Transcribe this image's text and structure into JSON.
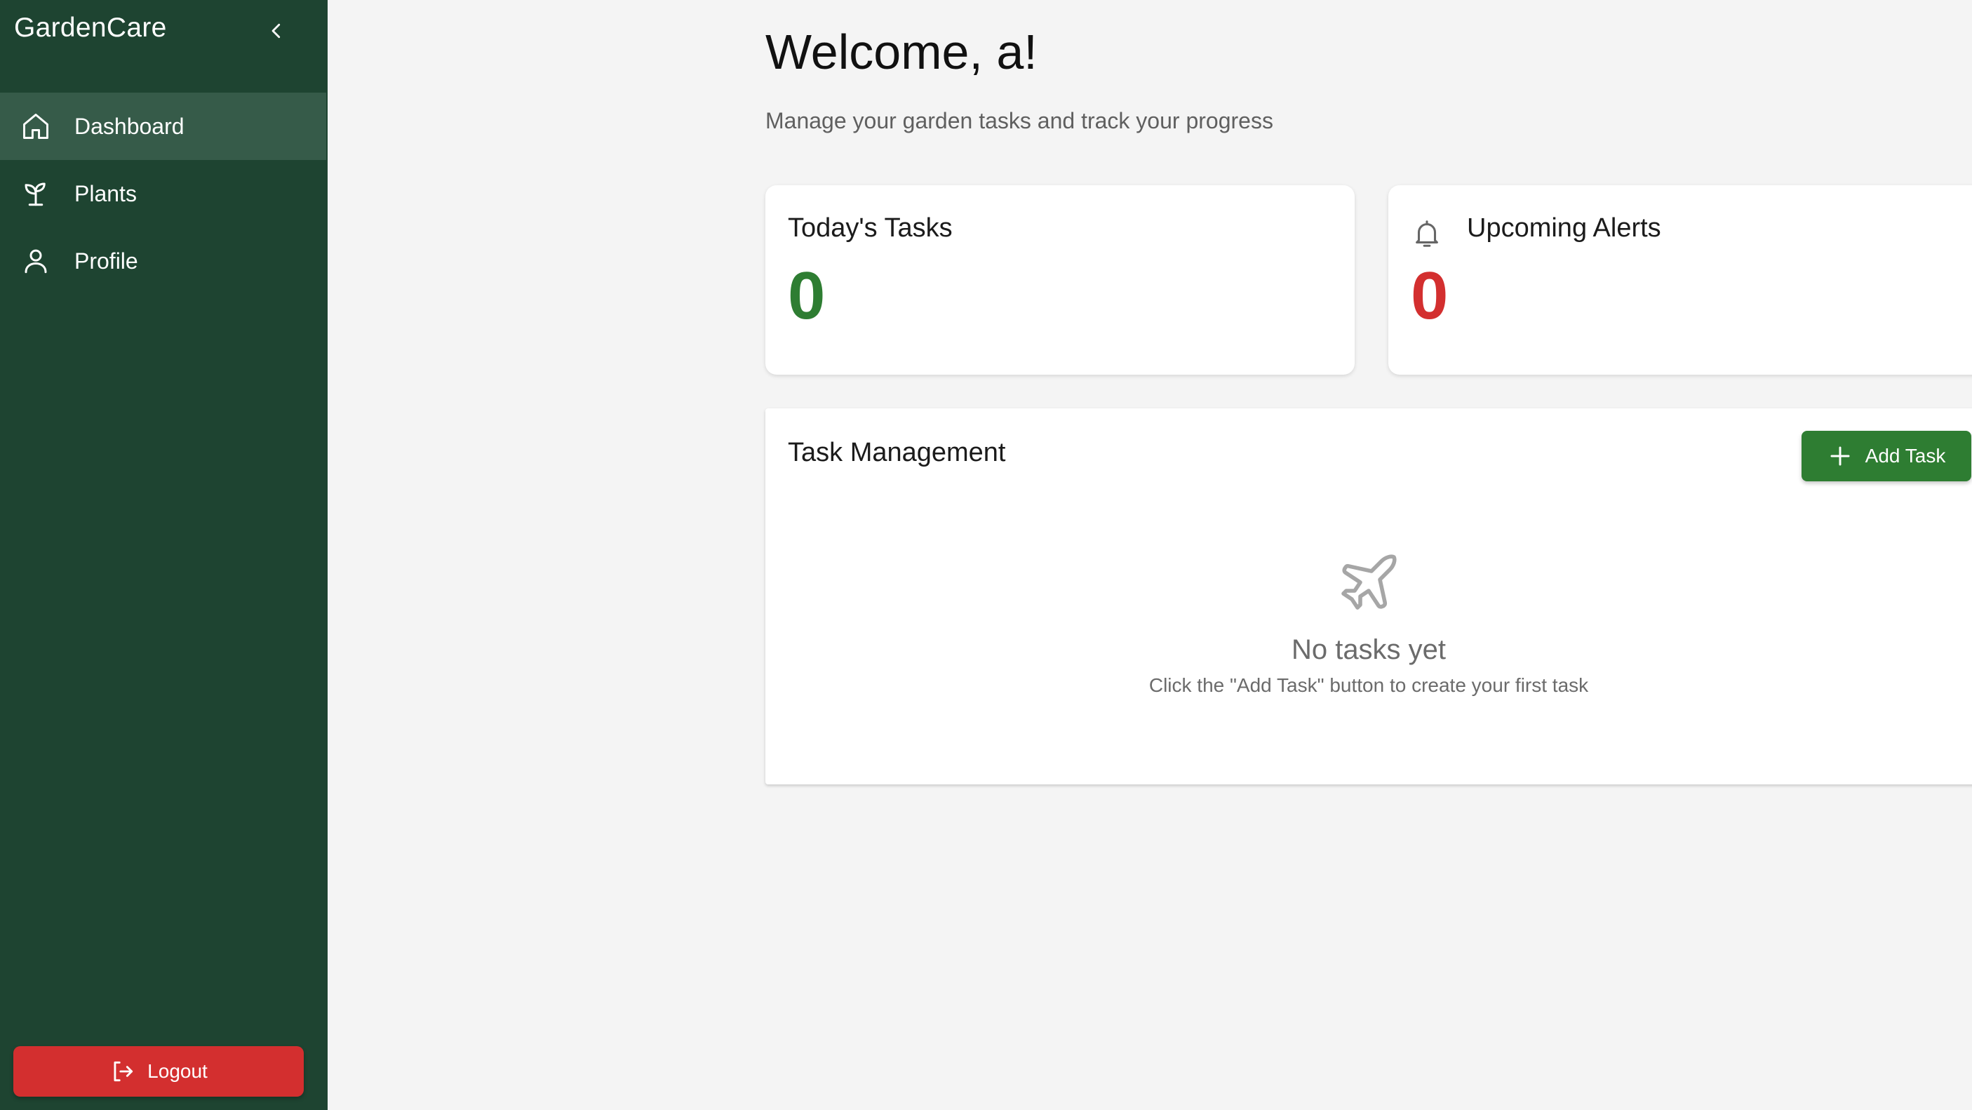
{
  "app": {
    "name": "GardenCare"
  },
  "sidebar": {
    "items": [
      {
        "label": "Dashboard",
        "icon": "home-icon",
        "active": true
      },
      {
        "label": "Plants",
        "icon": "sprout-icon",
        "active": false
      },
      {
        "label": "Profile",
        "icon": "user-icon",
        "active": false
      }
    ],
    "logout_label": "Logout"
  },
  "header": {
    "welcome": "Welcome, a!",
    "subtitle": "Manage your garden tasks and track your progress"
  },
  "stats": {
    "tasks": {
      "title": "Today's Tasks",
      "value": "0",
      "color": "#2e7d32"
    },
    "alerts": {
      "title": "Upcoming Alerts",
      "value": "0",
      "color": "#d32f2f"
    }
  },
  "task_management": {
    "title": "Task Management",
    "add_label": "Add Task",
    "empty_title": "No tasks yet",
    "empty_hint": "Click the \"Add Task\" button to create your first task"
  },
  "colors": {
    "sidebar_bg": "#1e4431",
    "primary_green": "#2e7d32",
    "danger_red": "#d32f2f"
  }
}
